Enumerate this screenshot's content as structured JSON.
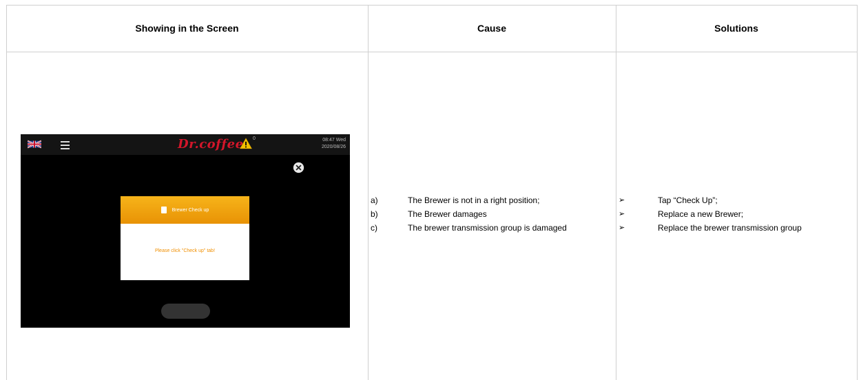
{
  "table": {
    "headers": [
      "Showing in the Screen",
      "Cause",
      "Solutions"
    ]
  },
  "device": {
    "brand": "Dr.coffee",
    "warning_count": "0",
    "time": "08:47 Wed",
    "date": "2020/08/26",
    "dialog_title": "Brewer Check up",
    "dialog_message": "Please click \"Check up\" tab!",
    "icons": {
      "flag": "uk-flag-icon",
      "menu": "hamburger-menu-icon",
      "warning": "warning-icon",
      "close": "close-icon",
      "dialog": "document-icon"
    },
    "colors": {
      "brand": "#d3162a",
      "dialog_header": "#f0a20e",
      "message": "#f08f00"
    }
  },
  "causes": [
    {
      "marker": "a)",
      "text": "The Brewer is not in a right position;"
    },
    {
      "marker": "b)",
      "text": "The Brewer damages"
    },
    {
      "marker": "c)",
      "text": "The brewer transmission group is damaged"
    }
  ],
  "solutions": [
    {
      "marker": "➢",
      "text": "Tap “Check Up”;"
    },
    {
      "marker": "➢",
      "text": "Replace a new Brewer;"
    },
    {
      "marker": "➢",
      "text": "Replace the brewer transmission group"
    }
  ]
}
